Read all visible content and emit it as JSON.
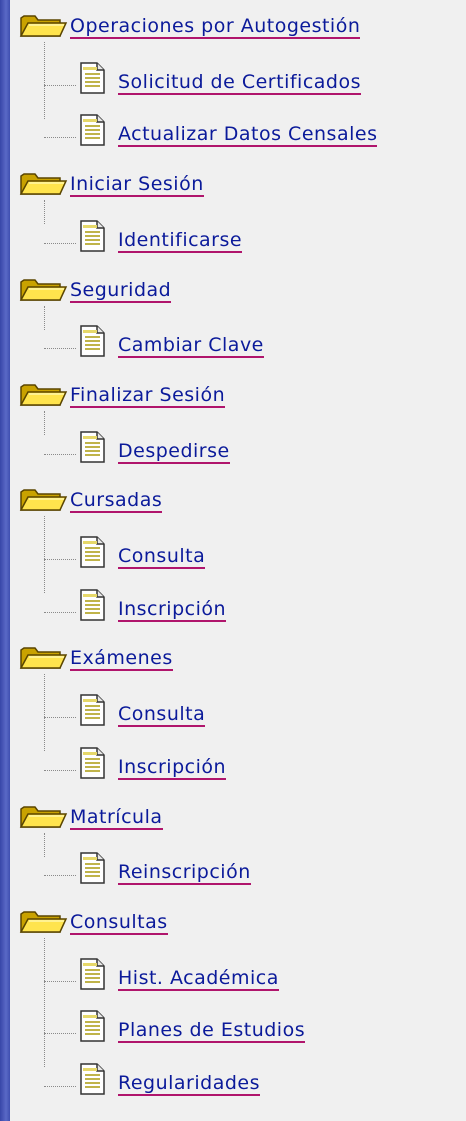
{
  "tree": {
    "groups": [
      {
        "label": "Operaciones por Autogestión",
        "items": [
          {
            "label": "Solicitud de Certificados"
          },
          {
            "label": "Actualizar Datos Censales"
          }
        ]
      },
      {
        "label": "Iniciar Sesión",
        "items": [
          {
            "label": "Identificarse"
          }
        ]
      },
      {
        "label": "Seguridad",
        "items": [
          {
            "label": "Cambiar Clave"
          }
        ]
      },
      {
        "label": "Finalizar Sesión",
        "items": [
          {
            "label": "Despedirse"
          }
        ]
      },
      {
        "label": "Cursadas",
        "items": [
          {
            "label": "Consulta"
          },
          {
            "label": "Inscripción"
          }
        ]
      },
      {
        "label": "Exámenes",
        "items": [
          {
            "label": "Consulta"
          },
          {
            "label": "Inscripción"
          }
        ]
      },
      {
        "label": "Matrícula",
        "items": [
          {
            "label": "Reinscripción"
          }
        ]
      },
      {
        "label": "Consultas",
        "items": [
          {
            "label": "Hist. Académica"
          },
          {
            "label": "Planes de Estudios"
          },
          {
            "label": "Regularidades"
          }
        ]
      }
    ]
  },
  "colors": {
    "link": "#0b1a9a",
    "underline": "#b0156c",
    "panel": "#f0f0f0",
    "frame": "#3746a8"
  }
}
